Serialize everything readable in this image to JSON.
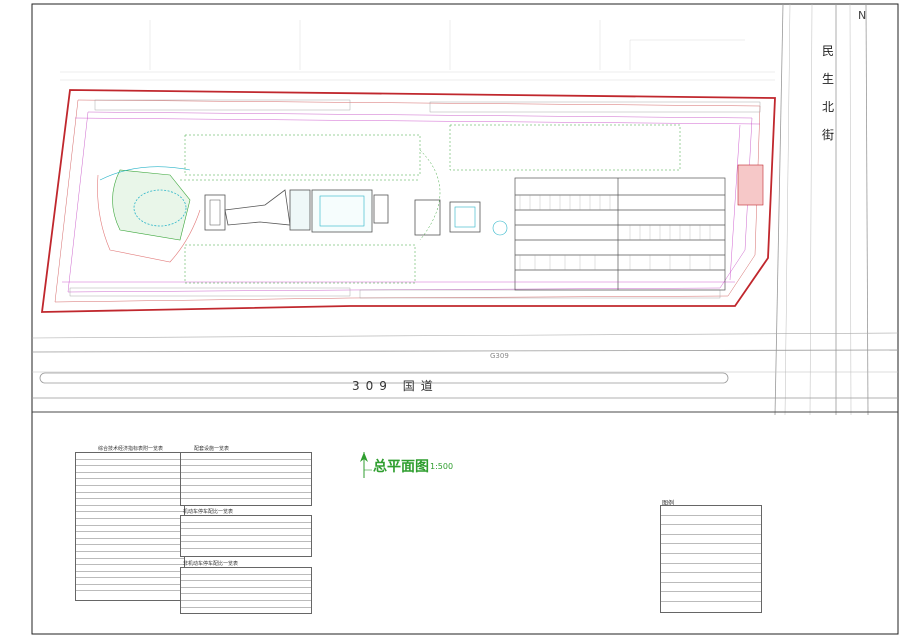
{
  "drawing": {
    "title": "总平面图",
    "scale": "1:500",
    "north_marker": "N",
    "road_main": "309 国道",
    "road_code": "G309",
    "street_right": [
      "民",
      "生",
      "北",
      "街"
    ]
  },
  "tables": {
    "indicators": {
      "title": "综合技术经济指标表附一览表"
    },
    "facilities": {
      "title": "配套设施一览表"
    },
    "vehicle_parking": {
      "title": "机动车停车配比一览表"
    },
    "bicycle_parking": {
      "title": "非机动车停车配比一览表"
    },
    "legend": {
      "title": "图例"
    }
  },
  "colors": {
    "site_boundary": "#c0272d",
    "green": "#3aa63a",
    "cyan": "#2bb5c9",
    "magenta": "#c43ac4",
    "roadline": "#9a9a9a",
    "building": "#555555"
  }
}
